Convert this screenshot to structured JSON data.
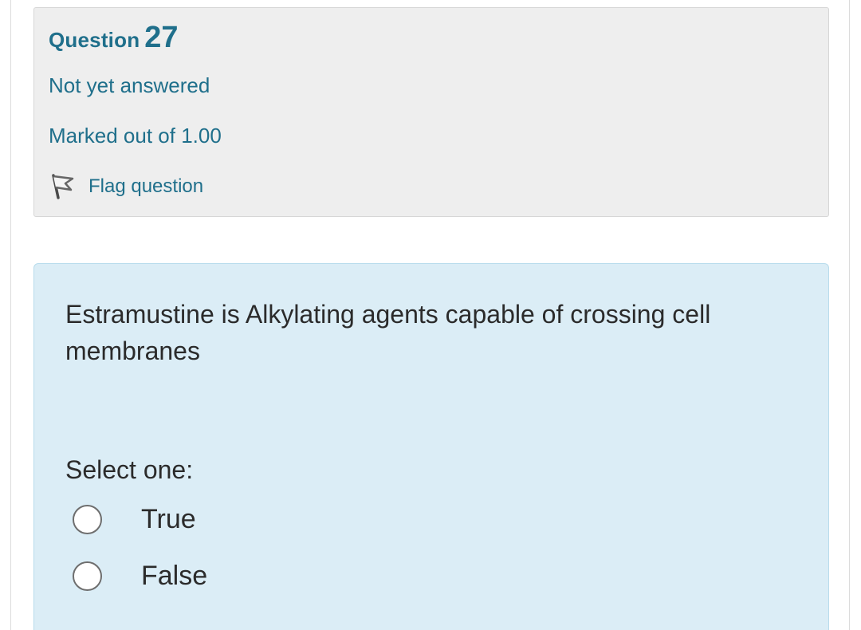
{
  "question": {
    "label": "Question",
    "number": "27",
    "state": "Not yet answered",
    "grade": "Marked out of 1.00",
    "flag_label": "Flag question",
    "flag_icon": "flag-icon"
  },
  "content": {
    "text": "Estramustine is Alkylating agents capable of crossing cell membranes",
    "prompt": "Select one:",
    "options": [
      {
        "label": "True",
        "selected": false
      },
      {
        "label": "False",
        "selected": false
      }
    ]
  },
  "colors": {
    "info_bg": "#eeeeee",
    "content_bg": "#dbedf6",
    "accent_text": "#1f6f8b",
    "body_text": "#2b2b2b"
  }
}
